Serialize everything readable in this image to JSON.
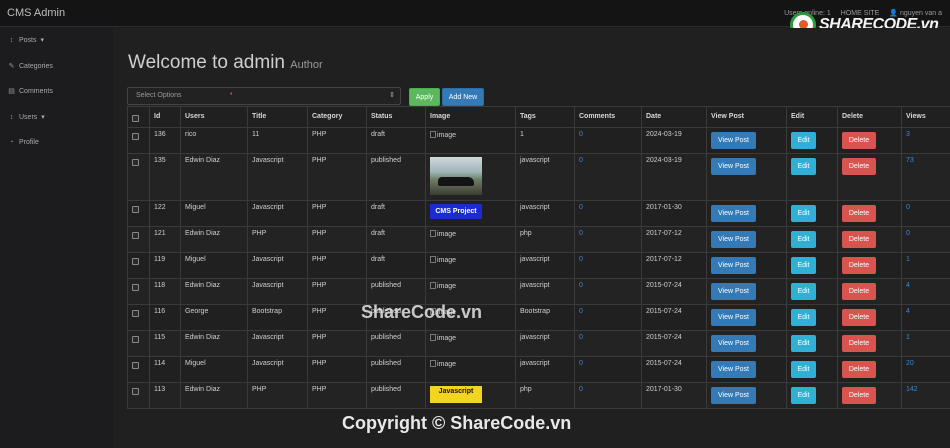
{
  "navbar": {
    "brand": "CMS Admin",
    "users_online": "Users online: 1",
    "home_site": "HOME SITE",
    "user_name": "nguyen van a",
    "user_icon": "user-icon"
  },
  "logo": {
    "text": "SHARECODE.vn"
  },
  "sidebar": {
    "items": [
      {
        "label": "Posts",
        "icon": "arrows-v-icon",
        "caret": "▾"
      },
      {
        "label": "Categories",
        "icon": "wrench-icon"
      },
      {
        "label": "Comments",
        "icon": "file-icon"
      },
      {
        "label": "Users",
        "icon": "arrows-v-icon",
        "caret": "▾"
      },
      {
        "label": "Profile",
        "icon": "dashboard-icon"
      }
    ]
  },
  "header": {
    "title": "Welcome to admin",
    "subtitle": "Author"
  },
  "bulk": {
    "select_value": "Select Options",
    "apply_label": "Apply",
    "add_new_label": "Add New"
  },
  "table": {
    "columns": [
      "Id",
      "Users",
      "Title",
      "Category",
      "Status",
      "Image",
      "Tags",
      "Comments",
      "Date",
      "View Post",
      "Edit",
      "Delete",
      "Views"
    ],
    "buttons": {
      "view": "View Post",
      "edit": "Edit",
      "delete": "Delete"
    },
    "rows": [
      {
        "id": "136",
        "user": "rico",
        "title": "11",
        "category": "PHP",
        "status": "draft",
        "image": "image",
        "tags": "1",
        "comments": "0",
        "date": "2024-03-19",
        "views": "3"
      },
      {
        "id": "135",
        "user": "Edwin Diaz",
        "title": "Javascript",
        "category": "PHP",
        "status": "published",
        "image": "car-photo",
        "tags": "javascript",
        "comments": "0",
        "date": "2024-03-19",
        "views": "73"
      },
      {
        "id": "122",
        "user": "Miguel",
        "title": "Javascript",
        "category": "PHP",
        "status": "draft",
        "image": "CMS Project",
        "tags": "javascript",
        "comments": "0",
        "date": "2017-01-30",
        "views": "0"
      },
      {
        "id": "121",
        "user": "Edwin Diaz",
        "title": "PHP",
        "category": "PHP",
        "status": "draft",
        "image": "image",
        "tags": "php",
        "comments": "0",
        "date": "2017-07-12",
        "views": "0"
      },
      {
        "id": "119",
        "user": "Miguel",
        "title": "Javascript",
        "category": "PHP",
        "status": "draft",
        "image": "image",
        "tags": "javascript",
        "comments": "0",
        "date": "2017-07-12",
        "views": "1"
      },
      {
        "id": "118",
        "user": "Edwin Diaz",
        "title": "Javascript",
        "category": "PHP",
        "status": "published",
        "image": "image",
        "tags": "javascript",
        "comments": "0",
        "date": "2015-07-24",
        "views": "4"
      },
      {
        "id": "116",
        "user": "George",
        "title": "Bootstrap",
        "category": "PHP",
        "status": "published",
        "image": "image",
        "tags": "Bootstrap",
        "comments": "0",
        "date": "2015-07-24",
        "views": "4"
      },
      {
        "id": "115",
        "user": "Edwin Diaz",
        "title": "Javascript",
        "category": "PHP",
        "status": "published",
        "image": "image",
        "tags": "javascript",
        "comments": "0",
        "date": "2015-07-24",
        "views": "1"
      },
      {
        "id": "114",
        "user": "Miguel",
        "title": "Javascript",
        "category": "PHP",
        "status": "published",
        "image": "image",
        "tags": "javascript",
        "comments": "0",
        "date": "2015-07-24",
        "views": "20"
      },
      {
        "id": "113",
        "user": "Edwin Diaz",
        "title": "PHP",
        "category": "PHP",
        "status": "published",
        "image": "Javascript",
        "tags": "php",
        "comments": "0",
        "date": "2017-01-30",
        "views": "142"
      }
    ]
  },
  "watermarks": {
    "middle": "ShareCode.vn",
    "bottom": "Copyright © ShareCode.vn"
  }
}
